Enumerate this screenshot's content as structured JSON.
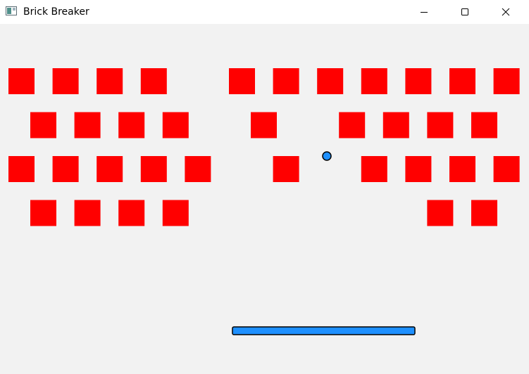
{
  "window": {
    "title": "Brick Breaker",
    "icon": "app-window-icon",
    "controls": [
      "minimize-icon",
      "maximize-icon",
      "close-icon"
    ]
  },
  "colors": {
    "board_background": "#f2f2f2",
    "brick": "#ff0000",
    "ball": "#1e90ff",
    "paddle": "#1e90ff",
    "outline": "#000000"
  },
  "bricks": {
    "rows": [
      [
        1,
        1,
        1,
        1,
        0,
        1,
        1,
        1,
        1,
        1,
        1,
        1
      ],
      [
        1,
        1,
        1,
        1,
        0,
        1,
        0,
        1,
        1,
        1,
        1
      ],
      [
        1,
        1,
        1,
        1,
        1,
        0,
        1,
        0,
        1,
        1,
        1,
        1
      ],
      [
        1,
        1,
        1,
        1,
        0,
        0,
        0,
        0,
        0,
        1,
        1
      ]
    ]
  }
}
